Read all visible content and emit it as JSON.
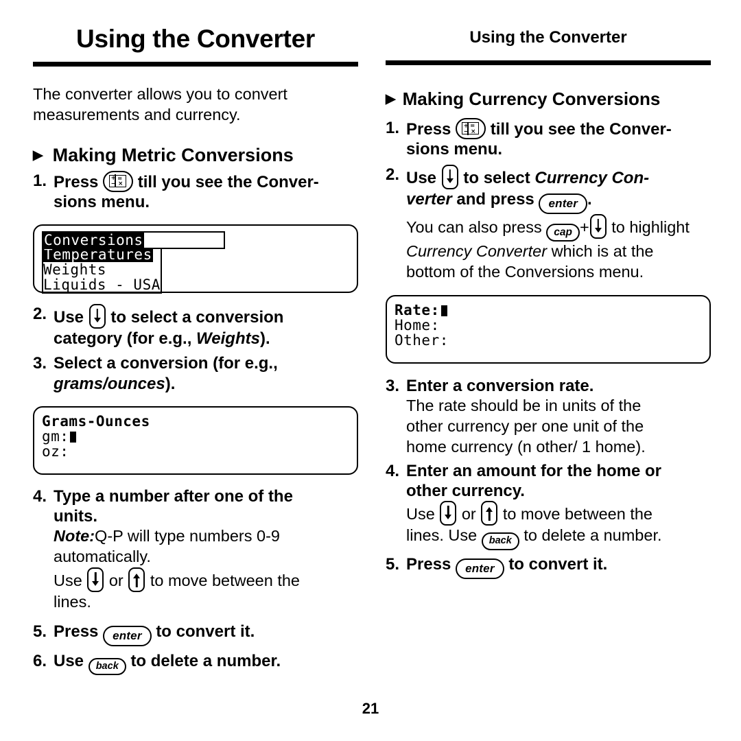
{
  "page_number": "21",
  "left": {
    "header": "Using the Converter",
    "intro": "The converter allows you to convert measurements and currency.",
    "section_heading": "Making Metric Conversions",
    "steps": {
      "s1_num": "1.",
      "s1_a": "Press",
      "s1_b": "till you see the Conver-",
      "s1_c": "sions menu.",
      "s2_num": "2.",
      "s2_a": "Use",
      "s2_b": "to select a conversion",
      "s2_c": "category (for e.g.,",
      "s2_italic": "Weights",
      "s2_d": ").",
      "s3_num": "3.",
      "s3_a": "Select a conversion (for e.g.,",
      "s3_italic": "grams/ounces",
      "s3_b": ").",
      "s4_num": "4.",
      "s4_a": "Type a number after one of the",
      "s4_b": "units.",
      "s4_note_label": "Note:",
      "s4_note_a": "Q-P will type numbers 0-9",
      "s4_note_b": "automatically.",
      "s4_use": "Use",
      "s4_or": "or",
      "s4_move": "to move between the",
      "s4_lines": "lines.",
      "s5_num": "5.",
      "s5_a": "Press",
      "s5_b": "to convert it.",
      "s6_num": "6.",
      "s6_a": "Use",
      "s6_b": "to delete a number."
    },
    "lcd_conversions": {
      "title": "Conversions",
      "row1": "Temperatures",
      "row2": "Weights",
      "row3": "Liquids - USA"
    },
    "lcd_grams": {
      "title": "Grams-Ounces",
      "row1": "gm:",
      "row2": "oz:"
    }
  },
  "right": {
    "header": "Using the Converter",
    "section_heading": "Making Currency Conversions",
    "steps": {
      "s1_num": "1.",
      "s1_a": "Press",
      "s1_b": "till you see the Conver-",
      "s1_c": "sions menu.",
      "s2_num": "2.",
      "s2_a": "Use",
      "s2_b": "to select",
      "s2_italic": "Currency Con-",
      "s2_italic2": "verter",
      "s2_c": "and press",
      "s2_d": ".",
      "s2_note_a": "You can also press",
      "s2_note_plus": "+",
      "s2_note_b": "to highlight",
      "s2_note_italic": "Currency Converter",
      "s2_note_c": "which is at the",
      "s2_note_d": "bottom of the Conversions menu.",
      "s3_num": "3.",
      "s3_a": "Enter a conversion rate.",
      "s3_sub_a": "The rate should be in units of the",
      "s3_sub_b": "other currency per one unit of the",
      "s3_sub_c": "home currency (n other/ 1 home).",
      "s4_num": "4.",
      "s4_a": "Enter an amount for the home or",
      "s4_b": "other currency.",
      "s4_use": "Use",
      "s4_or": "or",
      "s4_move": "to move between the",
      "s4_lines": "lines. Use",
      "s4_delete": "to delete a number.",
      "s5_num": "5.",
      "s5_a": "Press",
      "s5_b": "to convert it."
    },
    "lcd_rate": {
      "row1": "Rate:",
      "row2": "Home:",
      "row3": "Other:"
    }
  },
  "keys": {
    "enter": "enter",
    "back": "back",
    "cap": "cap",
    "conv_plus": "+",
    "conv_equals": "=",
    "conv_minus": "−",
    "conv_times": "×"
  },
  "bullet": "▶"
}
